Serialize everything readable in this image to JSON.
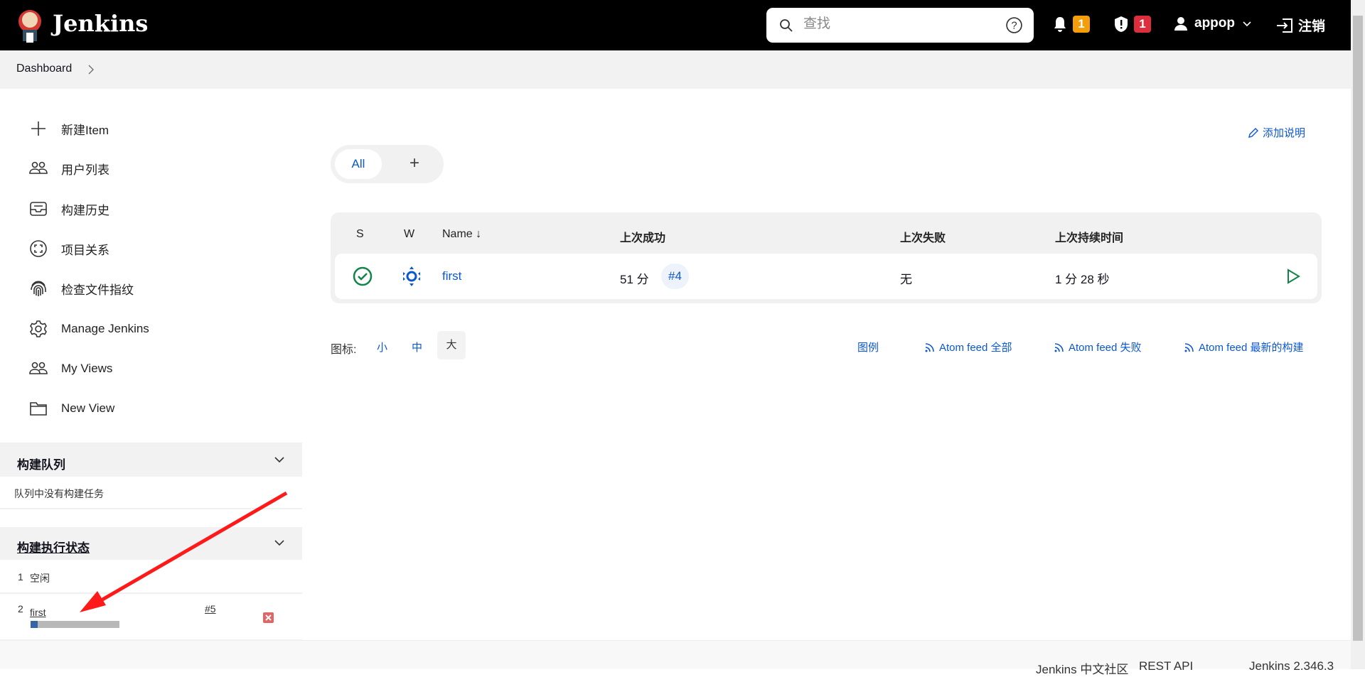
{
  "header": {
    "brand": "Jenkins",
    "search_placeholder": "查找",
    "notifications_count": "1",
    "security_count": "1",
    "user": "appop",
    "logout": "注销",
    "colors": {
      "notif": "#f59e0b",
      "security": "#dc2e3d"
    }
  },
  "breadcrumb": {
    "items": [
      "Dashboard"
    ]
  },
  "sidebar": {
    "items": [
      {
        "label": "新建Item",
        "icon": "plus-icon"
      },
      {
        "label": "用户列表",
        "icon": "people-icon"
      },
      {
        "label": "构建历史",
        "icon": "inbox-icon"
      },
      {
        "label": "项目关系",
        "icon": "relationship-icon"
      },
      {
        "label": "检查文件指纹",
        "icon": "fingerprint-icon"
      },
      {
        "label": "Manage Jenkins",
        "icon": "gear-icon"
      },
      {
        "label": "My Views",
        "icon": "people-icon"
      },
      {
        "label": "New View",
        "icon": "folder-icon"
      }
    ]
  },
  "queue": {
    "title": "构建队列",
    "empty": "队列中没有构建任务"
  },
  "executors": {
    "title": "构建执行状态",
    "rows": [
      {
        "num": "1",
        "status": "空闲"
      },
      {
        "num": "2",
        "job": "first",
        "build": "#5",
        "progress": 0.08
      }
    ]
  },
  "main": {
    "add_description": "添加说明",
    "tabs": [
      {
        "label": "All",
        "active": true
      },
      {
        "label": "+"
      }
    ],
    "table": {
      "headers": [
        "S",
        "W",
        "Name ↓",
        "上次成功",
        "上次失败",
        "上次持续时间"
      ],
      "rows": [
        {
          "status": "success",
          "weather": "sunny",
          "name": "first",
          "last_success": "51 分",
          "last_success_build": "#4",
          "last_failure": "无",
          "last_duration": "1 分 28 秒"
        }
      ]
    },
    "icon_size": {
      "label": "图标:",
      "options": [
        "小",
        "中",
        "大"
      ],
      "selected": "大"
    },
    "legend": "图例",
    "feeds": [
      "Atom feed 全部",
      "Atom feed 失败",
      "Atom feed 最新的构建"
    ]
  },
  "footer": {
    "links": [
      "Jenkins 中文社区",
      "REST API",
      "Jenkins 2.346.3"
    ]
  }
}
